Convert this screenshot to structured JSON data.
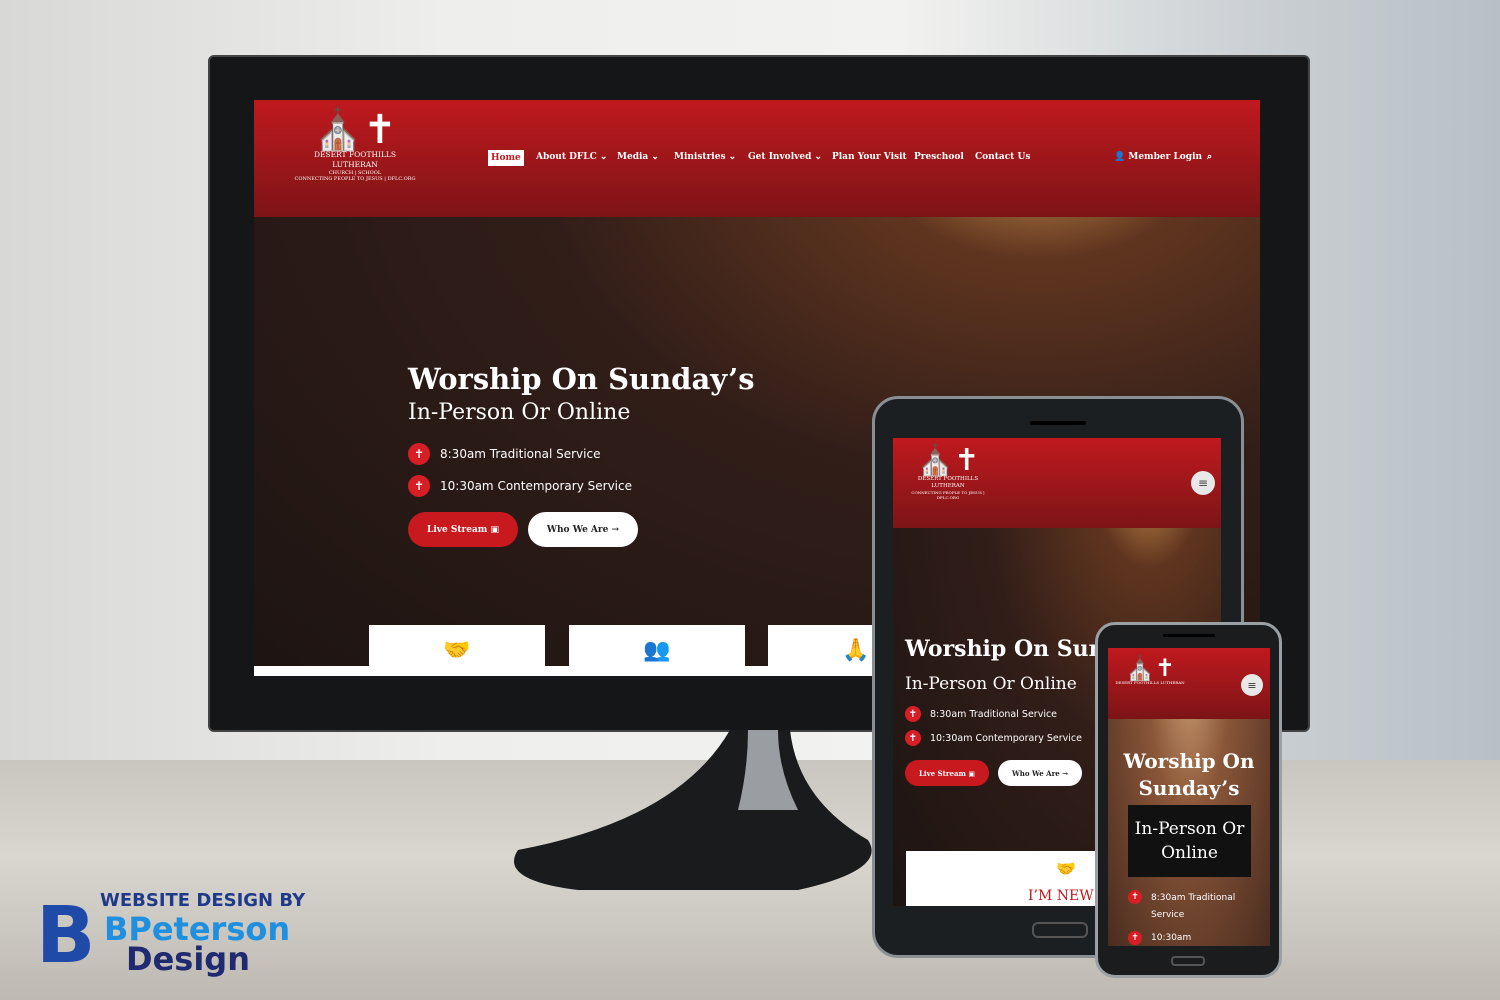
{
  "brand": {
    "line1": "WEBSITE DESIGN BY",
    "line2": "BPeterson",
    "line3": "Design",
    "color": "#1f4aa8"
  },
  "site": {
    "logo": {
      "name": "DESERT FOOTHILLS LUTHERAN",
      "sub": "CHURCH | SCHOOL",
      "tagline": "CONNECTING PEOPLE TO JESUS | DFLC.ORG"
    },
    "nav": [
      {
        "label": "Home",
        "active": true
      },
      {
        "label": "About DFLC ⌄"
      },
      {
        "label": "Media ⌄"
      },
      {
        "label": "Ministries ⌄"
      },
      {
        "label": "Get Involved ⌄"
      },
      {
        "label": "Plan Your Visit"
      },
      {
        "label": "Preschool"
      },
      {
        "label": "Contact Us"
      }
    ],
    "member_login": "Member Login",
    "search_icon": "search-icon",
    "hero": {
      "title": "Worship On Sunday’s",
      "title_tablet": "Worship On Sunda",
      "subtitle": "In-Person Or Online",
      "services": [
        "8:30am Traditional Service",
        "10:30am Contemporary Service"
      ],
      "live_stream": "Live Stream",
      "who_we_are": "Who We Are"
    },
    "phone": {
      "title": "Worship On Sunday’s",
      "subtitle": "In-Person Or Online",
      "service1a": "8:30am Traditional",
      "service1b": "Service",
      "service2": "10:30am"
    },
    "cards": {
      "im_new": "I’M NEW"
    },
    "colors": {
      "primary": "#c0191e",
      "white": "#ffffff"
    }
  }
}
